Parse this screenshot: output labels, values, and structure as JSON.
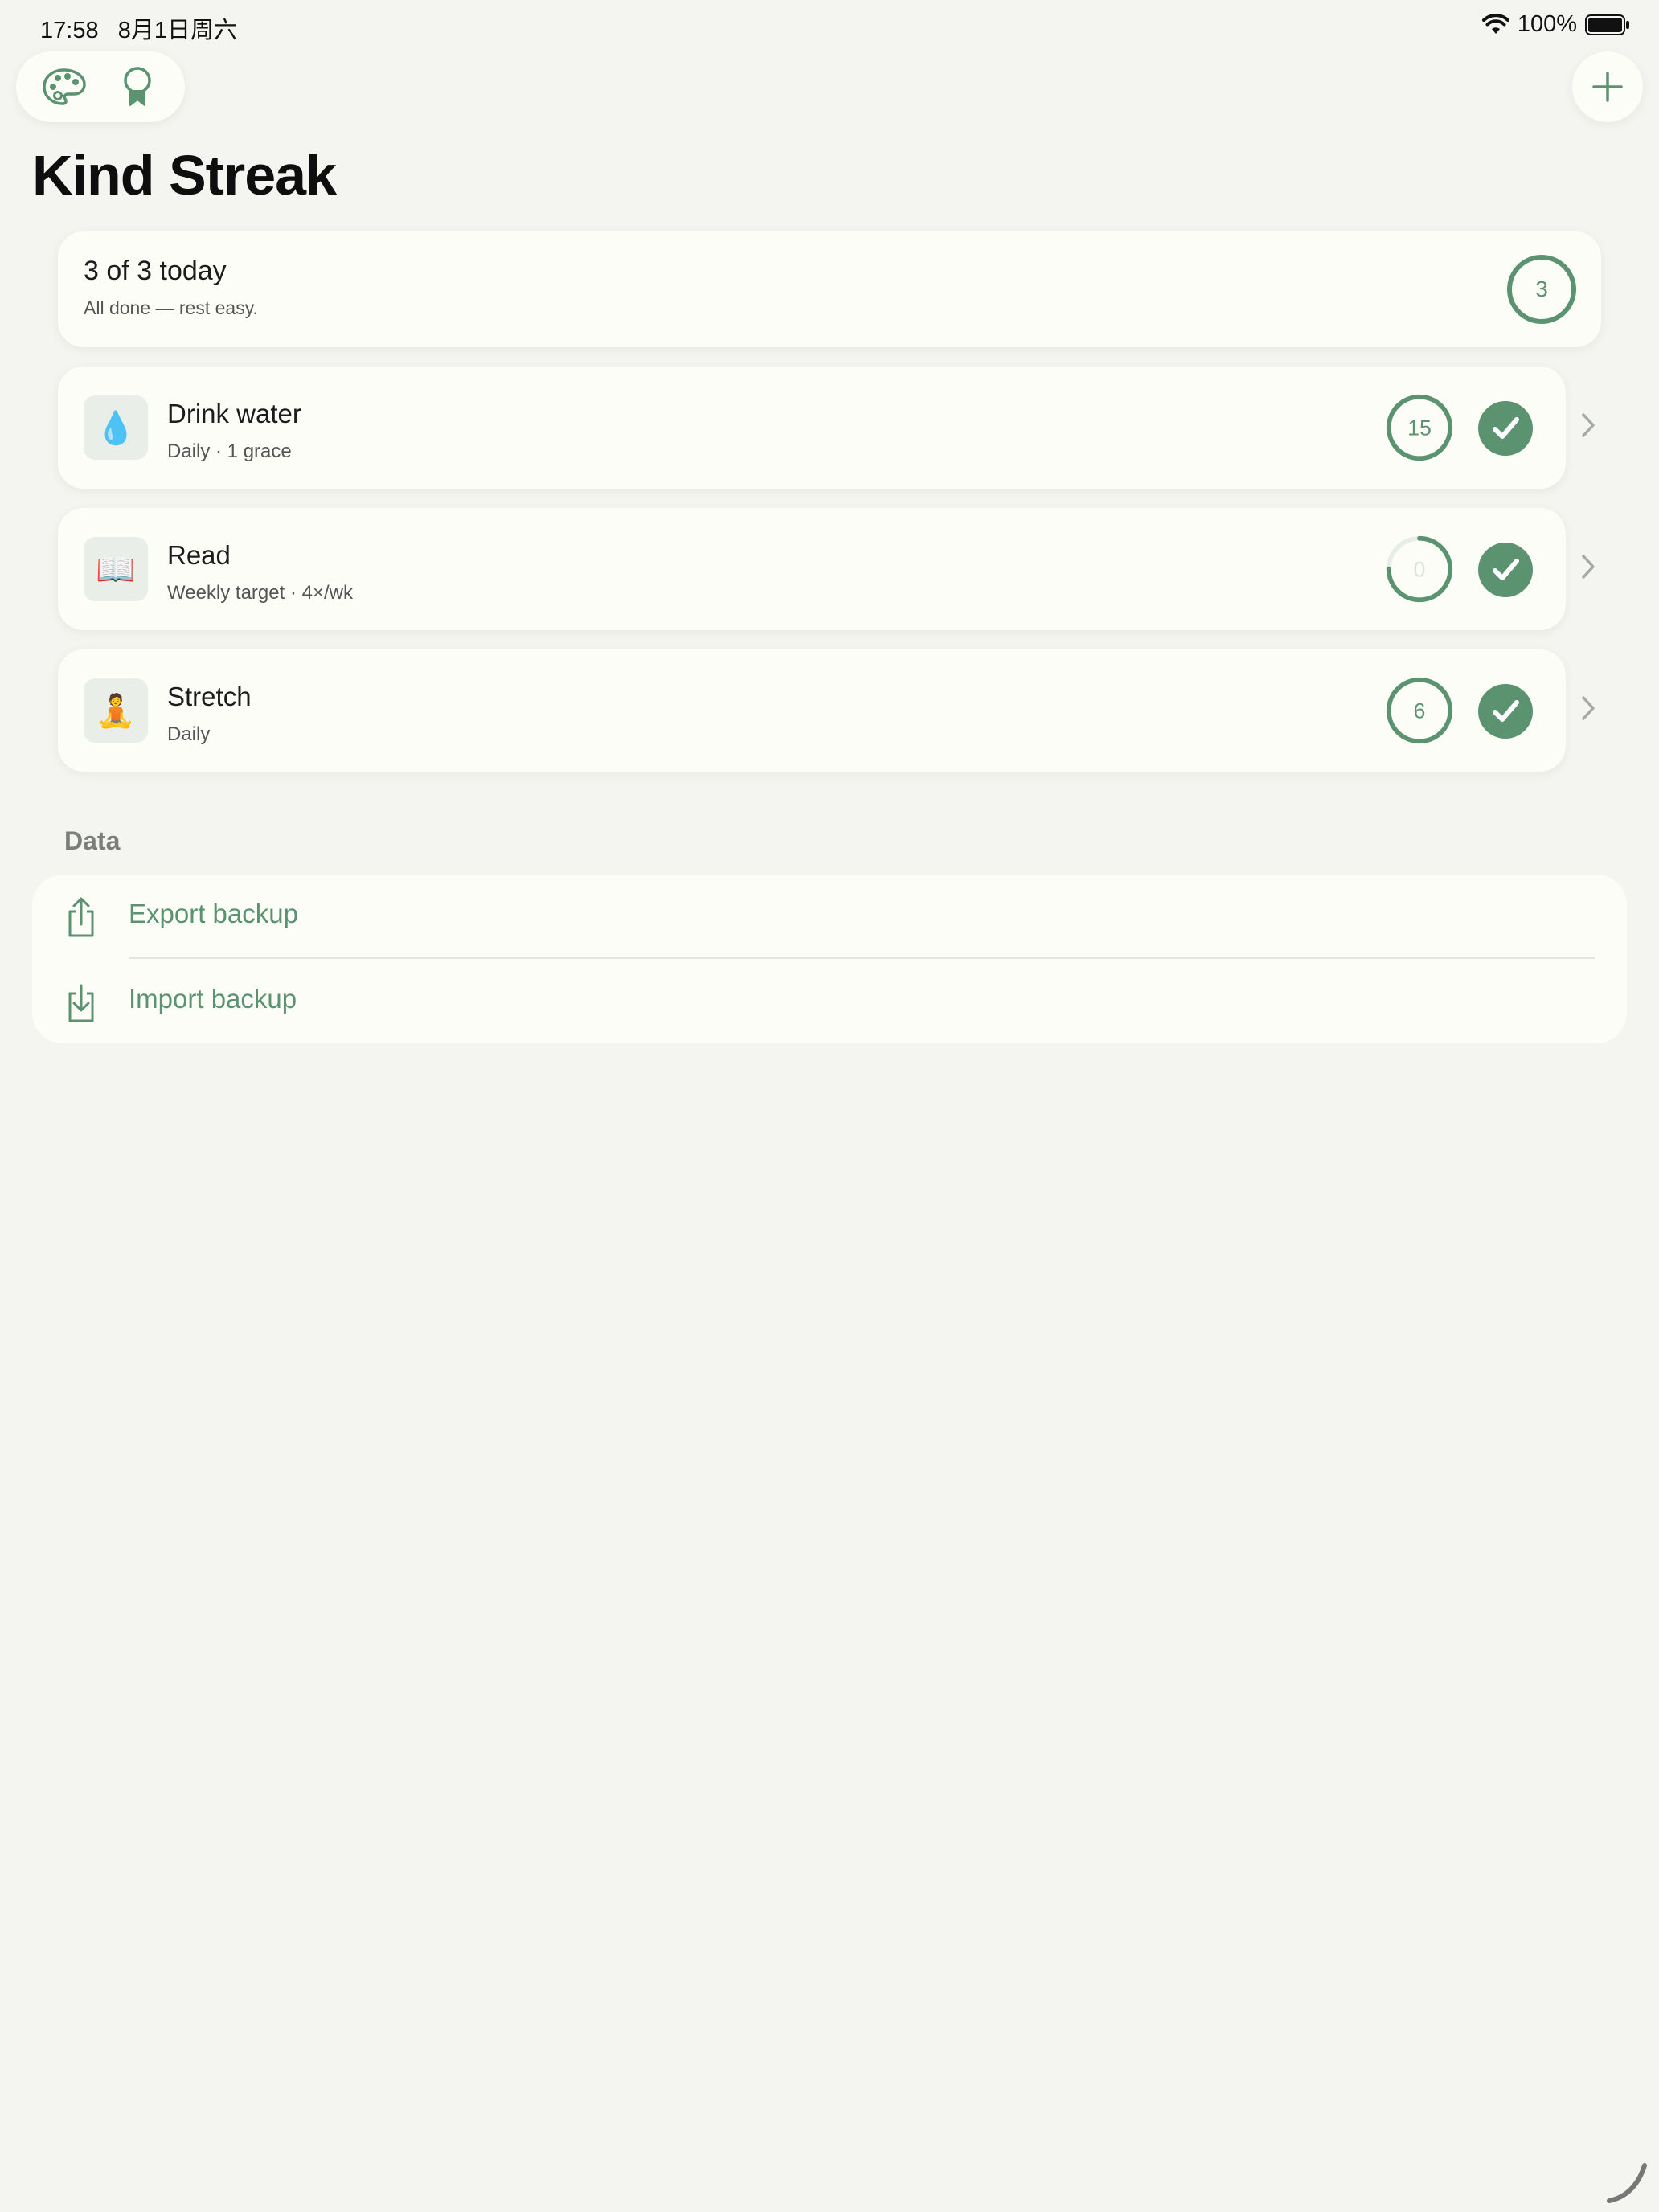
{
  "status_bar": {
    "time": "17:58",
    "date": "8月1日周六",
    "battery": "100%"
  },
  "toolbar": {
    "left_icons": [
      "palette-icon",
      "ribbon-icon"
    ],
    "add_icon": "plus-icon"
  },
  "title": "Kind Streak",
  "summary": {
    "main": "3 of 3 today",
    "sub": "All done — rest easy.",
    "count": "3"
  },
  "habits": [
    {
      "emoji": "💧",
      "name": "Drink water",
      "meta": "Daily · 1 grace",
      "streak": "15",
      "progress": 1.0,
      "done": true
    },
    {
      "emoji": "📖",
      "name": "Read",
      "meta": "Weekly target · 4×/wk",
      "streak": "0",
      "progress": 0.75,
      "done": true
    },
    {
      "emoji": "🧘",
      "name": "Stretch",
      "meta": "Daily",
      "streak": "6",
      "progress": 1.0,
      "done": true
    }
  ],
  "data_section": {
    "label": "Data",
    "items": [
      {
        "label": "Export backup",
        "icon": "share-icon"
      },
      {
        "label": "Import backup",
        "icon": "import-icon"
      }
    ]
  },
  "colors": {
    "accent": "#5b9270",
    "background": "#f4f5f0",
    "card": "#fcfdf7"
  }
}
